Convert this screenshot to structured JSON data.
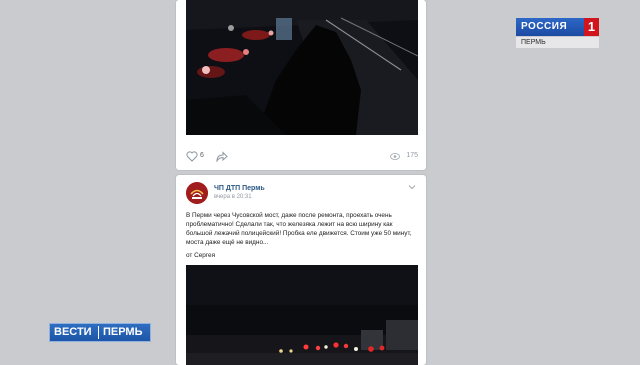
{
  "post1": {
    "likes": "6",
    "views": "175"
  },
  "post2": {
    "author": "ЧП ДТП Пермь",
    "time": "вчера в 20:31",
    "text": "В Перми через Чусовской мост, даже после ремонта, проехать очень проблематично! Сделали так, что железяка лежит на всю ширину как большой лежачий полицейский! Пробка еле движется. Стоим уже 50 минут, моста даже ещё не видно...",
    "signature": "от Сергея"
  },
  "channel": {
    "name": "РОССИЯ",
    "number": "1",
    "city": "ПЕРМЬ"
  },
  "program": {
    "left": "ВЕСТИ",
    "right": "ПЕРМЬ"
  }
}
